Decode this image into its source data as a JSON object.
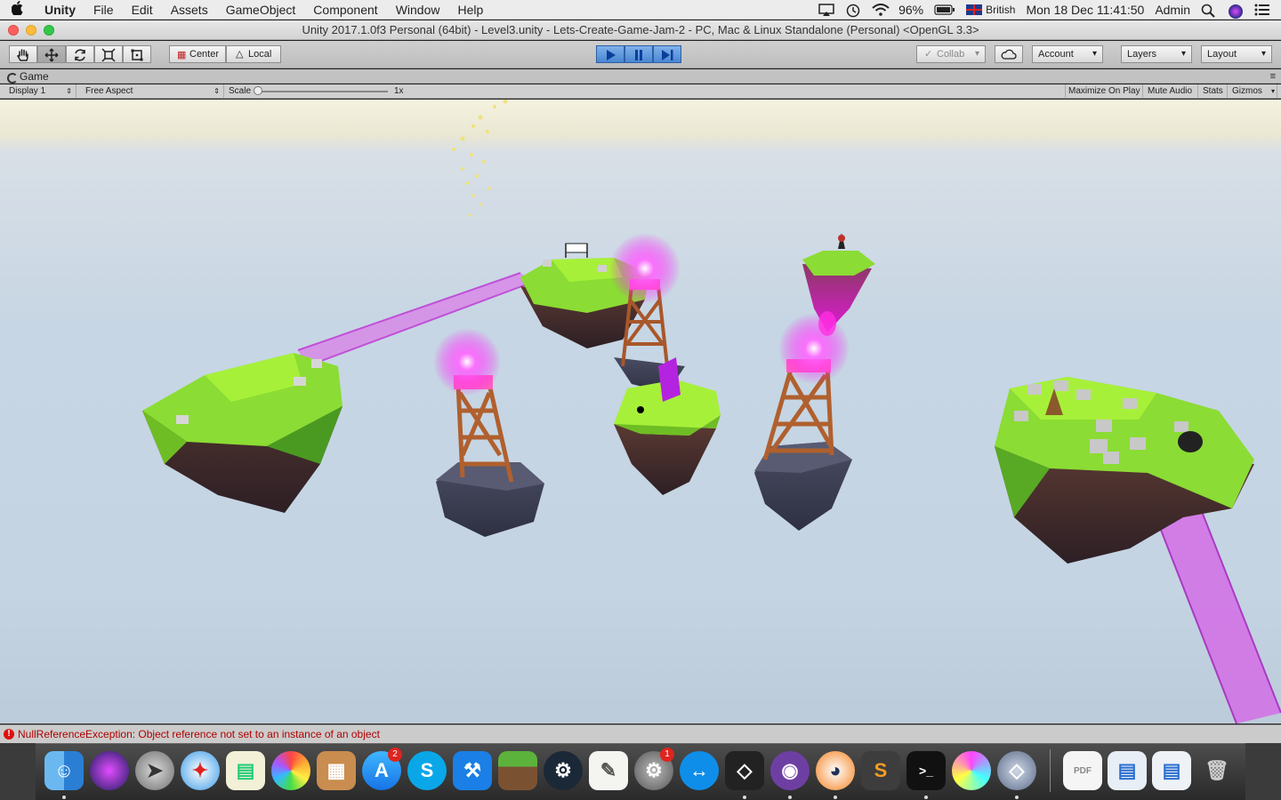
{
  "menubar": {
    "app": "Unity",
    "items": [
      "File",
      "Edit",
      "Assets",
      "GameObject",
      "Component",
      "Window",
      "Help"
    ],
    "battery": "96%",
    "input_source": "British",
    "clock": "Mon 18 Dec  11:41:50",
    "user": "Admin"
  },
  "window": {
    "title": "Unity 2017.1.0f3 Personal (64bit) - Level3.unity - Lets-Create-Game-Jam-2 - PC, Mac & Linux Standalone (Personal) <OpenGL 3.3>"
  },
  "toolbar": {
    "pivot_label": "Center",
    "space_label": "Local",
    "collab_label": "Collab",
    "account_label": "Account",
    "layers_label": "Layers",
    "layout_label": "Layout"
  },
  "game_view": {
    "tab_label": "Game",
    "display": "Display 1",
    "aspect": "Free Aspect",
    "scale_label": "Scale",
    "scale_value": "1x",
    "scale_fraction": 0.0,
    "maximize_label": "Maximize On Play",
    "mute_label": "Mute Audio",
    "stats_label": "Stats",
    "gizmos_label": "Gizmos"
  },
  "console": {
    "message": "NullReferenceException: Object reference not set to an instance of an object"
  },
  "dock": {
    "badges": {
      "app_store": "2",
      "system_preferences": "1"
    }
  }
}
